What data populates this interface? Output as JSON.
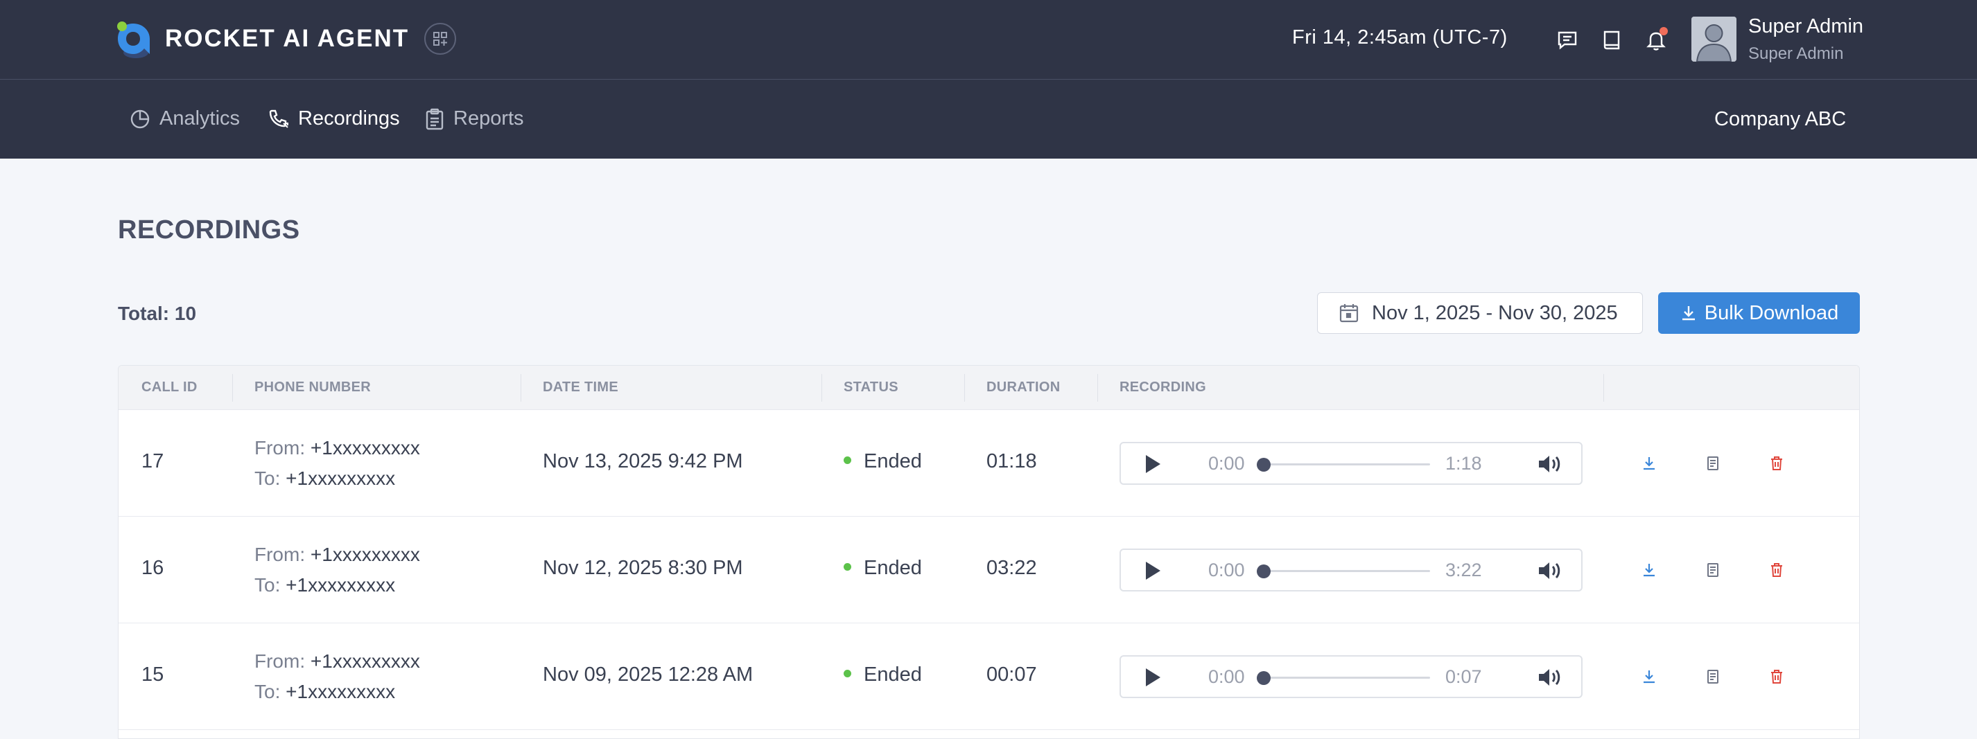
{
  "header": {
    "brand": "ROCKET AI AGENT",
    "datetime": "Fri 14, 2:45am (UTC-7)",
    "user_name": "Super Admin",
    "user_role": "Super Admin"
  },
  "nav": {
    "items": [
      {
        "label": "Analytics",
        "icon": "pie-chart-icon"
      },
      {
        "label": "Recordings",
        "icon": "phone-call-icon",
        "active": true
      },
      {
        "label": "Reports",
        "icon": "clipboard-icon"
      }
    ],
    "company": "Company ABC"
  },
  "page": {
    "title": "RECORDINGS",
    "total": "Total: 10",
    "date_range": "Nov 1, 2025 - Nov 30, 2025",
    "bulk_download": "Bulk Download"
  },
  "table": {
    "columns": [
      "CALL ID",
      "PHONE NUMBER",
      "DATE TIME",
      "STATUS",
      "DURATION",
      "RECORDING"
    ],
    "rows": [
      {
        "id": "17",
        "from_label": "From:",
        "from": "+1xxxxxxxxx",
        "to_label": "To:",
        "to": "+1xxxxxxxxx",
        "datetime": "Nov 13, 2025 9:42 PM",
        "status": "Ended",
        "duration": "01:18",
        "player_current": "0:00",
        "player_total": "1:18"
      },
      {
        "id": "16",
        "from_label": "From:",
        "from": "+1xxxxxxxxx",
        "to_label": "To:",
        "to": "+1xxxxxxxxx",
        "datetime": "Nov 12, 2025 8:30 PM",
        "status": "Ended",
        "duration": "03:22",
        "player_current": "0:00",
        "player_total": "3:22"
      },
      {
        "id": "15",
        "from_label": "From:",
        "from": "+1xxxxxxxxx",
        "to_label": "To:",
        "to": "+1xxxxxxxxx",
        "datetime": "Nov 09, 2025 12:28 AM",
        "status": "Ended",
        "duration": "00:07",
        "player_current": "0:00",
        "player_total": "0:07"
      }
    ]
  },
  "colors": {
    "header_bg": "#2f3446",
    "primary": "#3a86d9",
    "status_ended": "#5cc24a",
    "delete": "#e0463c",
    "notification": "#f06d5a"
  }
}
